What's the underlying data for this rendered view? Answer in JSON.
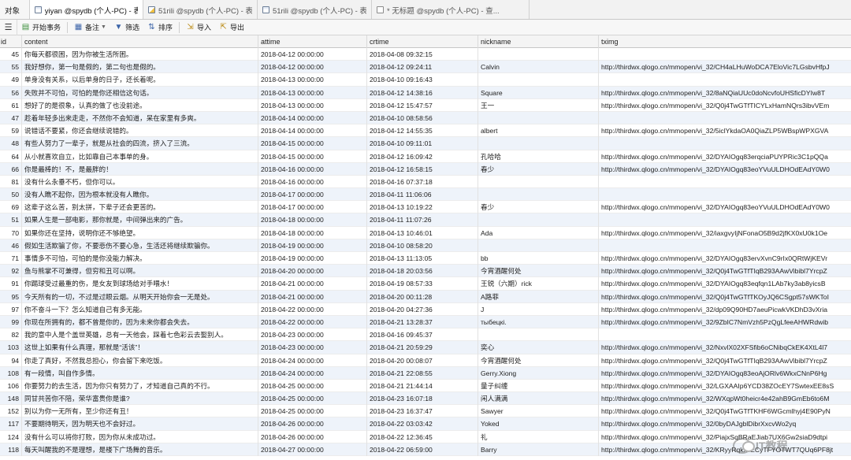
{
  "tabs": [
    {
      "label": "对象",
      "icon": "none"
    },
    {
      "label": "yiyan @spydb (个人-PC) - 表",
      "icon": "table-icon"
    },
    {
      "label": "51rili @spydb (个人-PC) - 表",
      "icon": "table-design-icon"
    },
    {
      "label": "51rili @spydb (个人-PC) - 表",
      "icon": "table-icon"
    },
    {
      "label": "* 无标题 @spydb (个人-PC) - 查...",
      "icon": "query-icon"
    }
  ],
  "toolbar": {
    "begin_label": "开始事务",
    "memo_label": "备注",
    "filter_label": "筛选",
    "sort_label": "排序",
    "import_label": "导入",
    "export_label": "导出"
  },
  "columns": [
    "id",
    "content",
    "attime",
    "crtime",
    "nickname",
    "tximg"
  ],
  "rows": [
    {
      "id": "45",
      "content": "你每天都很困，因为你被生活所困。",
      "attime": "2018-04-12 00:00:00",
      "crtime": "2018-04-08 09:32:15",
      "nickname": "",
      "tximg": ""
    },
    {
      "id": "55",
      "content": "我好想你，第一句是假的，第二句也是假的。",
      "attime": "2018-04-12 00:00:00",
      "crtime": "2018-04-12 09:24:11",
      "nickname": "Calvin",
      "tximg": "http://thirdwx.qlogo.cn/mmopen/vi_32/CH4aLHuWoDCA7EloVic7LGsbvHfpJ"
    },
    {
      "id": "49",
      "content": "单身没有关系，以后单身的日子，还长着呢。",
      "attime": "2018-04-13 00:00:00",
      "crtime": "2018-04-10 09:16:43",
      "nickname": "",
      "tximg": ""
    },
    {
      "id": "56",
      "content": "失败并不可怕，可怕的是你还相信这句话。",
      "attime": "2018-04-13 00:00:00",
      "crtime": "2018-04-12 14:38:16",
      "nickname": "Square",
      "tximg": "http://thirdwx.qlogo.cn/mmopen/vi_32/8aNQiaUUc0doNcvfoUHSficDYIw8T"
    },
    {
      "id": "61",
      "content": "想好了的是很象，认真的做了也没前途。",
      "attime": "2018-04-13 00:00:00",
      "crtime": "2018-04-12 15:47:57",
      "nickname": "王一",
      "tximg": "http://thirdwx.qlogo.cn/mmopen/vi_32/Q0j4TwGTfTICYLxHamNQrs3ibvVEm"
    },
    {
      "id": "47",
      "content": "趁着年轻多出来走走，不然你不会知道，呆在家里有多爽。",
      "attime": "2018-04-14 00:00:00",
      "crtime": "2018-04-10 08:58:56",
      "nickname": "",
      "tximg": ""
    },
    {
      "id": "59",
      "content": "说错话不要紧，你还会继续说错的。",
      "attime": "2018-04-14 00:00:00",
      "crtime": "2018-04-12 14:55:35",
      "nickname": "albert",
      "tximg": "http://thirdwx.qlogo.cn/mmopen/vi_32/5iclYkdaOA0QiaZLP5WBspWPXGVA"
    },
    {
      "id": "48",
      "content": "有些人努力了一辈子，就是从社会的四流，挤入了三流。",
      "attime": "2018-04-15 00:00:00",
      "crtime": "2018-04-10 09:11:01",
      "nickname": "",
      "tximg": ""
    },
    {
      "id": "64",
      "content": "从小就喜欢自立，比如靠自己本事单的身。",
      "attime": "2018-04-15 00:00:00",
      "crtime": "2018-04-12 16:09:42",
      "nickname": "孔哈哈",
      "tximg": "http://thirdwx.qlogo.cn/mmopen/vi_32/DYAIOgq83erqciaPUYPRic3C1pQQa"
    },
    {
      "id": "66",
      "content": "你是最棒的！不，是最胖的！",
      "attime": "2018-04-16 00:00:00",
      "crtime": "2018-04-12 16:58:15",
      "nickname": "春少",
      "tximg": "http://thirdwx.qlogo.cn/mmopen/vi_32/DYAIOgq83eoYVuULDHOdEAdY0W0"
    },
    {
      "id": "81",
      "content": "没有什么永垂不朽，但你可以。",
      "attime": "2018-04-16 00:00:00",
      "crtime": "2018-04-16 07:37:18",
      "nickname": "",
      "tximg": ""
    },
    {
      "id": "50",
      "content": "没有人瞧不起你，因为根本就没有人瞧你。",
      "attime": "2018-04-17 00:00:00",
      "crtime": "2018-04-11 11:06:06",
      "nickname": "",
      "tximg": ""
    },
    {
      "id": "69",
      "content": "这辈子这么苦，别太拼，下辈子还会更苦的。",
      "attime": "2018-04-17 00:00:00",
      "crtime": "2018-04-13 10:19:22",
      "nickname": "春少",
      "tximg": "http://thirdwx.qlogo.cn/mmopen/vi_32/DYAIOgq83eoYVuULDHOdEAdY0W0"
    },
    {
      "id": "51",
      "content": "如果人生是一部电影，那你就是，中间弹出来的广告。",
      "attime": "2018-04-18 00:00:00",
      "crtime": "2018-04-11 11:07:26",
      "nickname": "",
      "tximg": ""
    },
    {
      "id": "70",
      "content": "如果你还在坚持，说明你还不够绝望。",
      "attime": "2018-04-18 00:00:00",
      "crtime": "2018-04-13 10:46:01",
      "nickname": "Ada",
      "tximg": "http://thirdwx.qlogo.cn/mmopen/vi_32/iaxgvyIjNFonaO5B9d2jfKX0xU0k1Oe"
    },
    {
      "id": "46",
      "content": "假如生活欺骗了你，不要悲伤不要心急，生活还将继续欺骗你。",
      "attime": "2018-04-19 00:00:00",
      "crtime": "2018-04-10 08:58:20",
      "nickname": "",
      "tximg": ""
    },
    {
      "id": "71",
      "content": "事情多不可怕，可怕的是你没能力解决。",
      "attime": "2018-04-19 00:00:00",
      "crtime": "2018-04-13 11:13:05",
      "nickname": "bb",
      "tximg": "http://thirdwx.qlogo.cn/mmopen/vi_32/DYAIOgq83ervXvnC9rIx0QRtWjKEVr"
    },
    {
      "id": "92",
      "content": "鱼与熊掌不可兼得，但穷和丑可以啊。",
      "attime": "2018-04-20 00:00:00",
      "crtime": "2018-04-18 20:03:56",
      "nickname": "今宵酒醒何处",
      "tximg": "http://thirdwx.qlogo.cn/mmopen/vi_32/Q0j4TwGTfTIqB293AAwVibibl7YrcpZ"
    },
    {
      "id": "91",
      "content": "你踢球受过最重的伤，是女友到球场给对手喂水！",
      "attime": "2018-04-21 00:00:00",
      "crtime": "2018-04-19 08:57:33",
      "nickname": "王锐（六期）rick",
      "tximg": "http://thirdwx.qlogo.cn/mmopen/vi_32/DYAIOgq83eqfqn1LAb7ky3ab8yicsB"
    },
    {
      "id": "95",
      "content": "今天所有的一切，不过是过眼云烟。从明天开始你会一无是处。",
      "attime": "2018-04-21 00:00:00",
      "crtime": "2018-04-20 00:11:28",
      "nickname": "A路菲",
      "tximg": "http://thirdwx.qlogo.cn/mmopen/vi_32/Q0j4TwGTfTKOyJQ6CSgpt57sWKToI"
    },
    {
      "id": "97",
      "content": "你不奋斗一下？怎么知道自己有多无能。",
      "attime": "2018-04-22 00:00:00",
      "crtime": "2018-04-20 04:27:36",
      "nickname": "J",
      "tximg": "http://thirdwx.qlogo.cn/mmopen/vi_32/dp09Q90HD7aeuPicwkVKDhD3vXria"
    },
    {
      "id": "99",
      "content": "你现在所拥有的，都不曾是你的，因为未来你都会失去。",
      "attime": "2018-04-22 00:00:00",
      "crtime": "2018-04-21 13:28:37",
      "nickname": "тыбецкі.",
      "tximg": "http://thirdwx.qlogo.cn/mmopen/vi_32/9ZbIC7NmVzh5PzQgLfeeAHWRdwib"
    },
    {
      "id": "82",
      "content": "我的意中人是个盖世英雄，总有一天他会，踩着七色彩云去娶别人。",
      "attime": "2018-04-23 00:00:00",
      "crtime": "2018-04-16 09:45:37",
      "nickname": "",
      "tximg": ""
    },
    {
      "id": "103",
      "content": "这世上如果有什么真理，那就是“活该”！",
      "attime": "2018-04-23 00:00:00",
      "crtime": "2018-04-21 20:59:29",
      "nickname": "奕心",
      "tximg": "http://thirdwx.qlogo.cn/mmopen/vi_32/NxvlX02XFSfib6oCNibqCkEK4XtL4l7"
    },
    {
      "id": "94",
      "content": "你走了真好，不然我总担心，你会留下来吃饭。",
      "attime": "2018-04-24 00:00:00",
      "crtime": "2018-04-20 00:08:07",
      "nickname": "今宵酒醒何处",
      "tximg": "http://thirdwx.qlogo.cn/mmopen/vi_32/Q0j4TwGTfTIqB293AAwVibibl7YrcpZ"
    },
    {
      "id": "108",
      "content": "有一段情，叫自作多情。",
      "attime": "2018-04-24 00:00:00",
      "crtime": "2018-04-21 22:08:55",
      "nickname": "Gerry.Xiong",
      "tximg": "http://thirdwx.qlogo.cn/mmopen/vi_32/DYAIOgq83eoAjORlv6WkxCNnP6Hg"
    },
    {
      "id": "106",
      "content": "你要努力的去生活，因为你只有努力了，才知道自己真的不行。",
      "attime": "2018-04-25 00:00:00",
      "crtime": "2018-04-21 21:44:14",
      "nickname": "量子纠缠",
      "tximg": "http://thirdwx.qlogo.cn/mmopen/vi_32/LGXAAIp6YCD38ZOcEY7SwtexEE8sS"
    },
    {
      "id": "148",
      "content": "同甘共苦你不陪，荣华富贵你是谁?",
      "attime": "2018-04-25 00:00:00",
      "crtime": "2018-04-23 16:07:18",
      "nickname": "闲人满满",
      "tximg": "http://thirdwx.qlogo.cn/mmopen/vi_32/WXqpWt0heicr4e42ahB9GmEb6to6M"
    },
    {
      "id": "152",
      "content": "别以为你一无所有，至少你还有丑！",
      "attime": "2018-04-25 00:00:00",
      "crtime": "2018-04-23 16:37:47",
      "nickname": "Sawyer",
      "tximg": "http://thirdwx.qlogo.cn/mmopen/vi_32/Q0j4TwGTfTKHF6WGcmlhyj4E90PyN"
    },
    {
      "id": "117",
      "content": "不要期待明天，因为明天也不会好过。",
      "attime": "2018-04-26 00:00:00",
      "crtime": "2018-04-22 03:03:42",
      "nickname": "Yoked",
      "tximg": "http://thirdwx.qlogo.cn/mmopen/vi_32/0byDAJgblDibrXxcvWo2yq"
    },
    {
      "id": "124",
      "content": "没有什么可以将你打败，因为你从未成功过。",
      "attime": "2018-04-26 00:00:00",
      "crtime": "2018-04-22 12:36:45",
      "nickname": "礼",
      "tximg": "http://thirdwx.qlogo.cn/mmopen/vi_32/PiajxSqBRaEJiab7UX6Gw2siaD9dtpi"
    },
    {
      "id": "118",
      "content": "每天叫醒我的不是理想，是楼下广场舞的音乐。",
      "attime": "2018-04-27 00:00:00",
      "crtime": "2018-04-22 06:59:00",
      "nickname": "Barry",
      "tximg": "http://thirdwx.qlogo.cn/mmopen/vi_32/KRyyRqkxvECyTFYOTWT7QUq6PF8jt"
    }
  ],
  "watermark": {
    "text": "IT教程"
  }
}
